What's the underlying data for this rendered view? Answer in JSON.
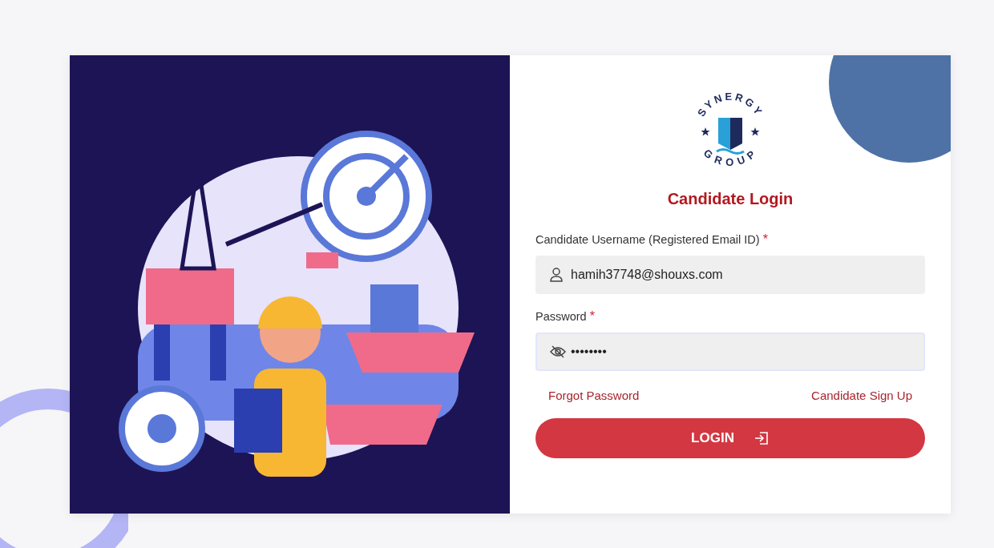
{
  "logo": {
    "top_text": "SYNERGY",
    "bottom_text": "GROUP"
  },
  "title": "Candidate Login",
  "fields": [
    {
      "kind": "text",
      "label": "Candidate Username (Registered Email ID)",
      "required_mark": "*",
      "value": "hamih37748@shouxs.com",
      "focused": false
    },
    {
      "kind": "password",
      "label": "Password",
      "required_mark": "*",
      "value": "••••••••",
      "focused": true
    }
  ],
  "links": [
    "Forgot Password",
    "Candidate Sign Up"
  ],
  "submit": {
    "label": "LOGIN"
  }
}
